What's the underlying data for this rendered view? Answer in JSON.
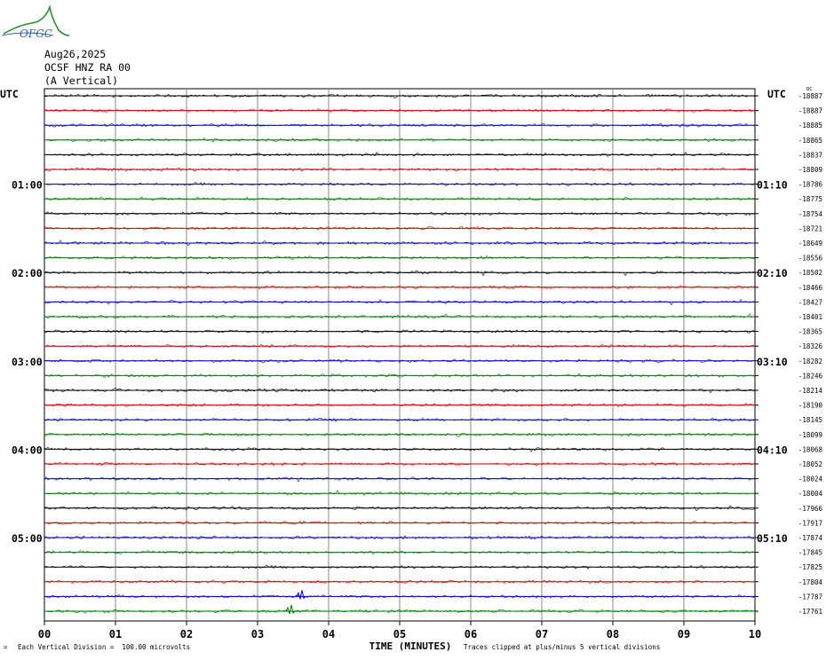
{
  "logo": {
    "text": "OFGC"
  },
  "header": {
    "date": "Aug26,2025",
    "station": "OCSF HNZ RA 00",
    "component": "(A Vertical)"
  },
  "colors": {
    "trace_cycle": [
      "#000000",
      "#d40000",
      "#0000d4",
      "#007a00"
    ],
    "grid": "#888888"
  },
  "footer": {
    "vertical_division": "Each Vertical Division =  100.00 microvolts",
    "clipped": "Traces clipped at plus/minus 5 vertical divisions",
    "mark": "="
  },
  "chart_data": {
    "type": "line",
    "title": "",
    "xlabel": "TIME (MINUTES)",
    "ylabel": "",
    "xlim": [
      0,
      10
    ],
    "x_ticks": [
      "00",
      "01",
      "02",
      "03",
      "04",
      "05",
      "06",
      "07",
      "08",
      "09",
      "10"
    ],
    "left_axis_label": "UTC",
    "right_axis_label": "UTC",
    "left_time_labels": [
      {
        "row": 6,
        "label": "01:00"
      },
      {
        "row": 12,
        "label": "02:00"
      },
      {
        "row": 18,
        "label": "03:00"
      },
      {
        "row": 24,
        "label": "04:00"
      },
      {
        "row": 30,
        "label": "05:00"
      }
    ],
    "right_time_labels": [
      {
        "row": 6,
        "label": "01:10"
      },
      {
        "row": 12,
        "label": "02:10"
      },
      {
        "row": 18,
        "label": "03:10"
      },
      {
        "row": 24,
        "label": "04:10"
      },
      {
        "row": 30,
        "label": "05:10"
      }
    ],
    "row_count": 36,
    "trace_offsets": [
      "-18887",
      "-18887",
      "-18885",
      "-18865",
      "-18837",
      "-18809",
      "-18786",
      "-18775",
      "-18754",
      "-18721",
      "-18649",
      "-18556",
      "-18502",
      "-18466",
      "-18427",
      "-18401",
      "-18365",
      "-18326",
      "-18282",
      "-18246",
      "-18214",
      "-18190",
      "-18145",
      "-18099",
      "-18068",
      "-18052",
      "-18024",
      "-18004",
      "-17966",
      "-17917",
      "-17874",
      "-17845",
      "-17825",
      "-17804",
      "-17787",
      "-17761"
    ],
    "first_offset_prefix": "DC",
    "events": [
      {
        "row": 34,
        "minute": 3.6
      },
      {
        "row": 35,
        "minute": 3.45
      }
    ]
  }
}
